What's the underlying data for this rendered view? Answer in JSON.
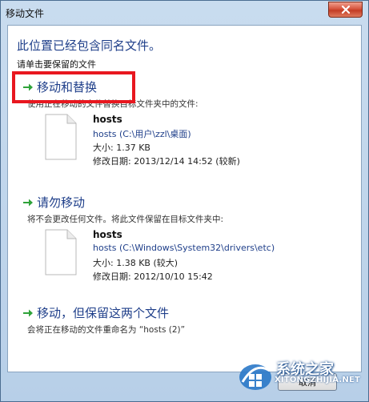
{
  "window": {
    "title": "移动文件"
  },
  "dialog": {
    "heading": "此位置已经包含同名文件。",
    "subheading": "请单击要保留的文件",
    "options": [
      {
        "title": "移动和替换",
        "description": "使用正在移动的文件替换目标文件夹中的文件:",
        "file": {
          "name": "hosts",
          "path": "hosts (C:\\用户\\zzl\\桌面)",
          "size": "大小: 1.37 KB",
          "date": "修改日期: 2013/12/14 14:52 (较新)"
        }
      },
      {
        "title": "请勿移动",
        "description": "将不会更改任何文件。将此文件保留在目标文件夹中:",
        "file": {
          "name": "hosts",
          "path": "hosts (C:\\Windows\\System32\\drivers\\etc)",
          "size": "大小: 1.38 KB (较大)",
          "date": "修改日期: 2012/10/10 15:42"
        }
      },
      {
        "title": "移动，但保留这两个文件",
        "description": "会将正在移动的文件重命名为 “hosts (2)”"
      }
    ],
    "cancel_label": "取消"
  },
  "watermark": {
    "name": "系统之家",
    "url": "XITONGZHIJIA.NET"
  },
  "colors": {
    "link": "#1f3f8a",
    "highlight": "#e8171f",
    "arrow": "#2fa33a"
  },
  "icons": {
    "close": "close-icon",
    "arrow": "green-arrow-icon",
    "file": "file-icon"
  }
}
